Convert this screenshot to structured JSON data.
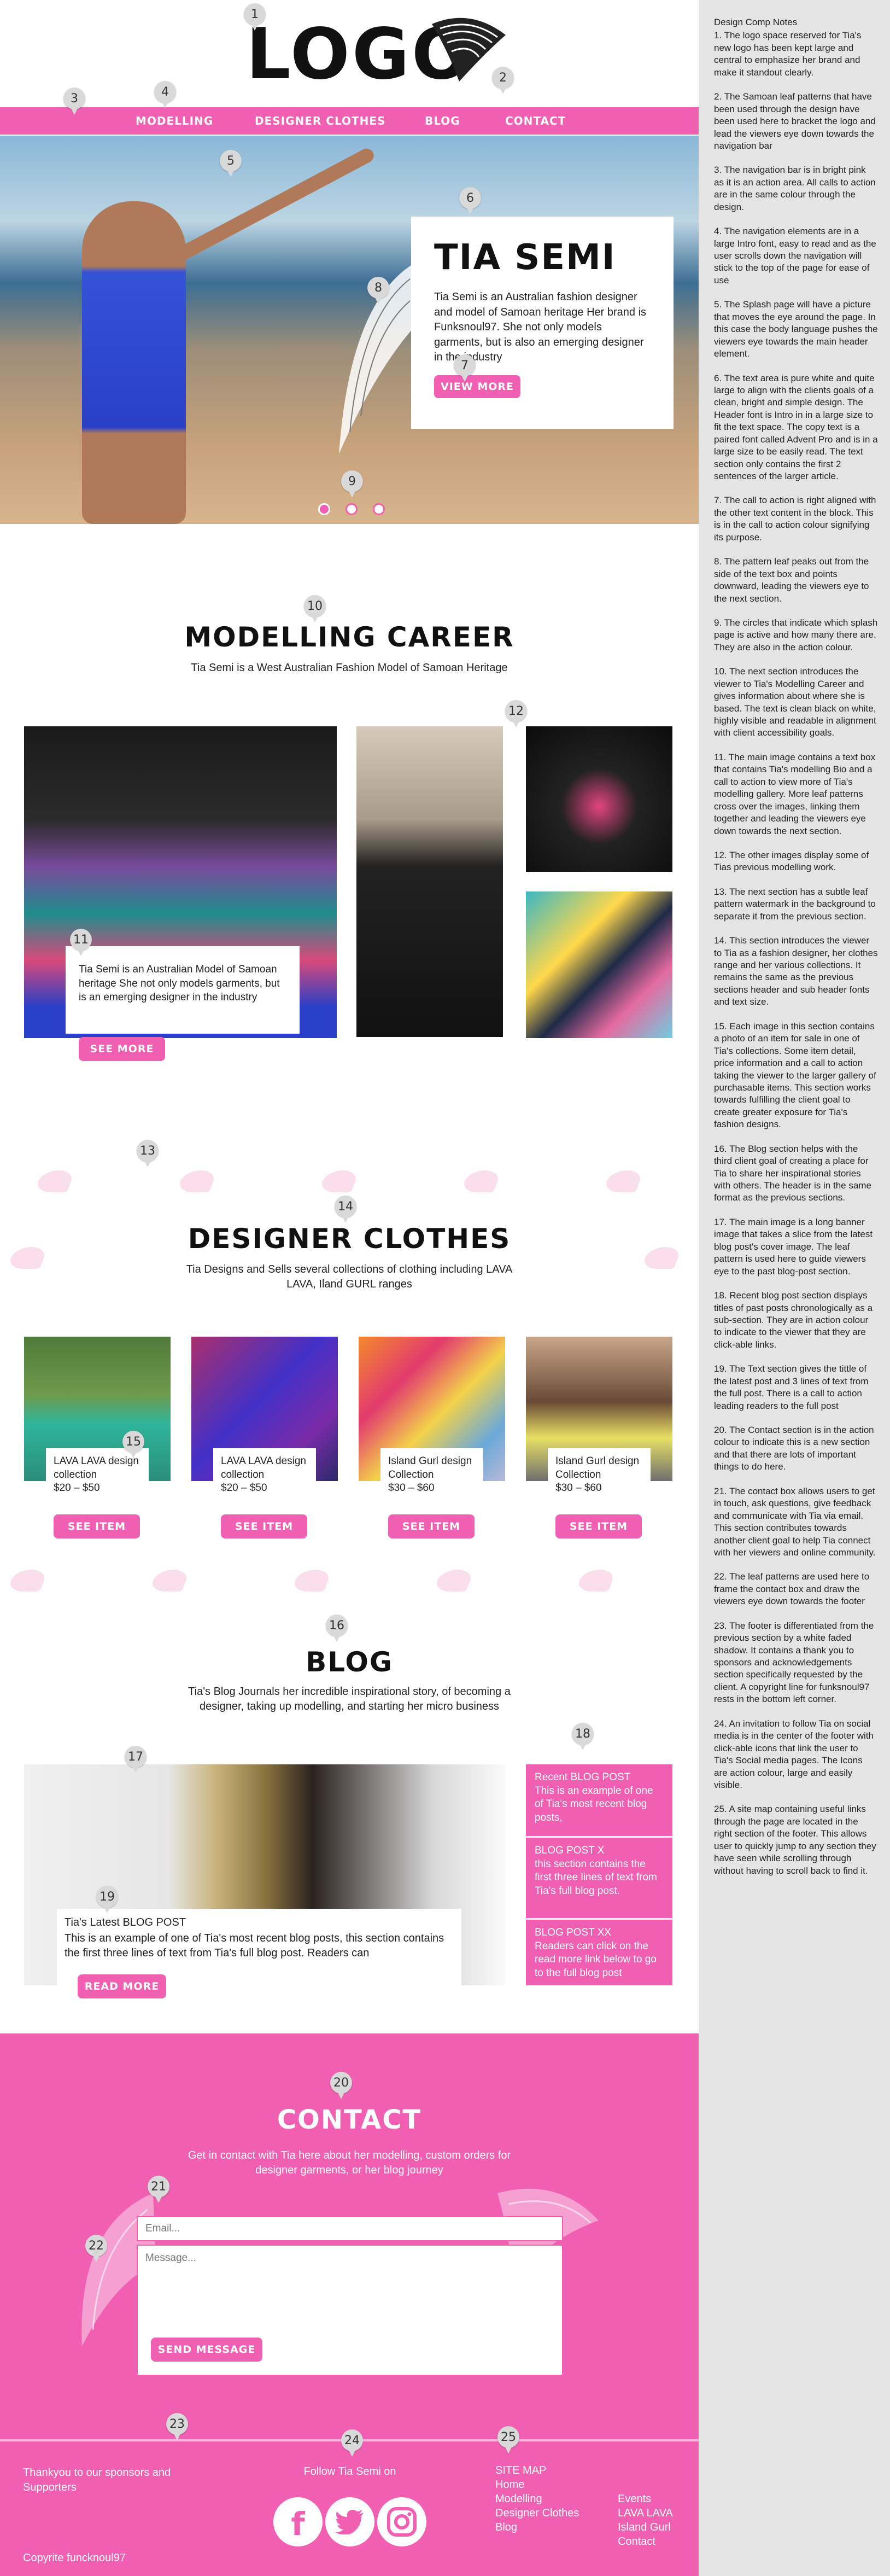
{
  "logo": {
    "text": "LOGO"
  },
  "pins": [
    "1",
    "2",
    "3",
    "4",
    "5",
    "6",
    "7",
    "8",
    "9",
    "10",
    "11",
    "12",
    "13",
    "14",
    "15",
    "16",
    "17",
    "18",
    "19",
    "20",
    "21",
    "22",
    "23",
    "24",
    "25"
  ],
  "nav": {
    "items": [
      "MODELLING",
      "DESIGNER CLOTHES",
      "BLOG",
      "CONTACT"
    ]
  },
  "hero": {
    "title": "TIA SEMI",
    "body": "Tia Semi is an Australian fashion designer and model of Samoan heritage Her brand is Funksnoul97. She not only models garments, but is also an emerging designer in the industry",
    "button": "VIEW MORE",
    "slides": 3,
    "active_slide": 1
  },
  "modelling": {
    "title": "MODELLING CAREER",
    "subtitle": "Tia Semi is a West Australian  Fashion Model of Samoan Heritage",
    "card_text": "Tia Semi is an Australian Model of Samoan heritage She not only models garments, but is an emerging designer in the industry",
    "button": "SEE MORE"
  },
  "designer": {
    "title": "DESIGNER CLOTHES",
    "subtitle": "Tia Designs and Sells several collections of clothing including LAVA LAVA, Iland GURL ranges",
    "items": [
      {
        "name": "LAVA LAVA design collection",
        "price": "$20 – $50",
        "button": "SEE ITEM"
      },
      {
        "name": "LAVA LAVA design collection",
        "price": "$20 – $50",
        "button": "SEE ITEM"
      },
      {
        "name": "Island Gurl design Collection",
        "price": "$30 – $60",
        "button": "SEE ITEM"
      },
      {
        "name": "Island Gurl design Collection",
        "price": "$30 – $60",
        "button": "SEE ITEM"
      }
    ]
  },
  "blog": {
    "title": "BLOG",
    "subtitle": "Tia's Blog Journals her incredible inspirational story, of becoming a designer, taking up modelling, and starting her micro business",
    "latest_title": "Tia's Latest BLOG POST",
    "latest_body": "This is an example of one of Tia's most recent blog posts, this section contains the first three lines of text from Tia's full blog post. Readers can",
    "button": "READ MORE",
    "posts": [
      {
        "title": "Recent BLOG POST",
        "body": "This is an example of one of Tia's most recent blog posts,"
      },
      {
        "title": "BLOG POST  X",
        "body": "this section contains the first three lines of text from Tia's full blog post."
      },
      {
        "title": "BLOG POST XX",
        "body": "Readers can click on the read more link below to go to the full blog post"
      }
    ]
  },
  "contact": {
    "title": "CONTACT",
    "subtitle": "Get in contact with Tia here about her modelling, custom orders for designer garments, or her blog journey",
    "email_placeholder": "Email...",
    "message_placeholder": "Message...",
    "button": "SEND MESSAGE"
  },
  "footer": {
    "thanks": "Thankyou to our sponsors and Supporters",
    "follow": "Follow Tia Semi on",
    "social": [
      "facebook-icon",
      "twitter-icon",
      "instagram-icon"
    ],
    "sitemap_title": "SITE MAP",
    "sitemap_col1": [
      "Home",
      "Modelling",
      "Designer Clothes",
      "Blog"
    ],
    "sitemap_col2": [
      "Events",
      "LAVA LAVA",
      "Island Gurl",
      "Contact"
    ],
    "copyright": "Copyrite funcknoul97"
  },
  "notes": {
    "title": "Design Comp Notes",
    "items": [
      "1. The logo space reserved for Tia's new logo has been kept large and central to emphasize her brand and make it standout clearly.",
      "2. The Samoan leaf patterns that have been used through the design have been used here to bracket the logo and lead the viewers eye down towards the navigation bar",
      "3. The navigation bar is in bright pink as it is an action area. All calls to action are in the same colour through the design.",
      "4. The navigation elements are in a large Intro font, easy to read and as the user scrolls down the navigation will stick to the top of the page for ease of use",
      "5. The Splash page will have a picture that moves the eye around the page. In this case the body language pushes the viewers eye towards the main header element.",
      "6. The text area is pure white and quite large to align with the clients goals of a clean, bright and simple design. The Header font is Intro in in a large size to fit the text space. The copy text is a paired font called Advent Pro and is in a large size to be easily read. The text section only contains the first 2 sentences of the larger article.",
      "7. The call to action is right aligned with the other text content in the block. This is in the call to action colour signifying its purpose.",
      "8. The pattern leaf peaks out from the side of the text box and points downward, leading the viewers eye to the next section.",
      "9. The circles that indicate which splash page is active and how many there are. They are also in the action colour.",
      "10. The next section introduces the viewer to Tia's Modelling Career and gives information about where she is based. The text is clean black on white, highly visible and readable in alignment with client accessibility goals.",
      "11. The main image contains a text box that contains Tia's modelling Bio and a call to action to view more of Tia's modelling gallery. More leaf patterns cross over the images, linking them together and leading the viewers eye down towards the next section.",
      "12. The other images display some of Tias previous modelling work.",
      "13. The next section has a subtle leaf pattern watermark in the background to separate it from the previous section.",
      "14. This section introduces the viewer to Tia as a fashion designer, her clothes range and her various collections. It remains the same as the previous sections header and sub header fonts and text size.",
      "15. Each image in this section contains a photo of an item for sale in one of Tia's collections. Some item detail, price information and a call to action taking the viewer to the larger gallery of purchasable items. This section works towards fulfilling the client goal to create greater exposure for Tia's fashion designs.",
      "16. The Blog section helps with the third client goal of creating a place for Tia to share her inspirational stories with others. The header is in the same format as the previous sections.",
      "17. The main image is a long banner image that takes a slice from the latest blog post's cover image. The leaf pattern is used here to guide viewers eye to the past blog-post section.",
      "18. Recent blog post section displays titles of past posts chronologically as a sub-section. They are in action colour to indicate to the viewer that they are click-able links.",
      "19. The Text section gives the tittle of the latest post and 3 lines of text from the full post. There is a call to action leading readers to the full post",
      "20. The Contact section is in the action colour to indicate this is a new section and that there are lots of important things to do here.",
      "21. The contact box allows users to get in touch, ask questions, give feedback and communicate with Tia via email. This section contributes towards another client goal to help Tia connect with her viewers and online community.",
      "22. The leaf patterns are used here to frame the contact box and draw the viewers eye down towards the footer",
      "23. The footer is differentiated from the previous section by a white faded shadow. It contains a thank you to sponsors and acknowledgements section specifically requested by the client. A copyright line for funksnoul97 rests in the bottom left corner.",
      "24. An invitation to follow Tia on social media is in the center of the footer with click-able icons that link the user to Tia's Social media pages. The Icons are action colour, large and easily visible.",
      "25. A site map containing useful links through the page are located in the right section of the footer. This allows user to quickly jump to any section they have seen while scrolling through without having to scroll back to find it."
    ]
  },
  "colors": {
    "accent": "#f05fb2",
    "notes_bg": "#e4e4e4"
  }
}
